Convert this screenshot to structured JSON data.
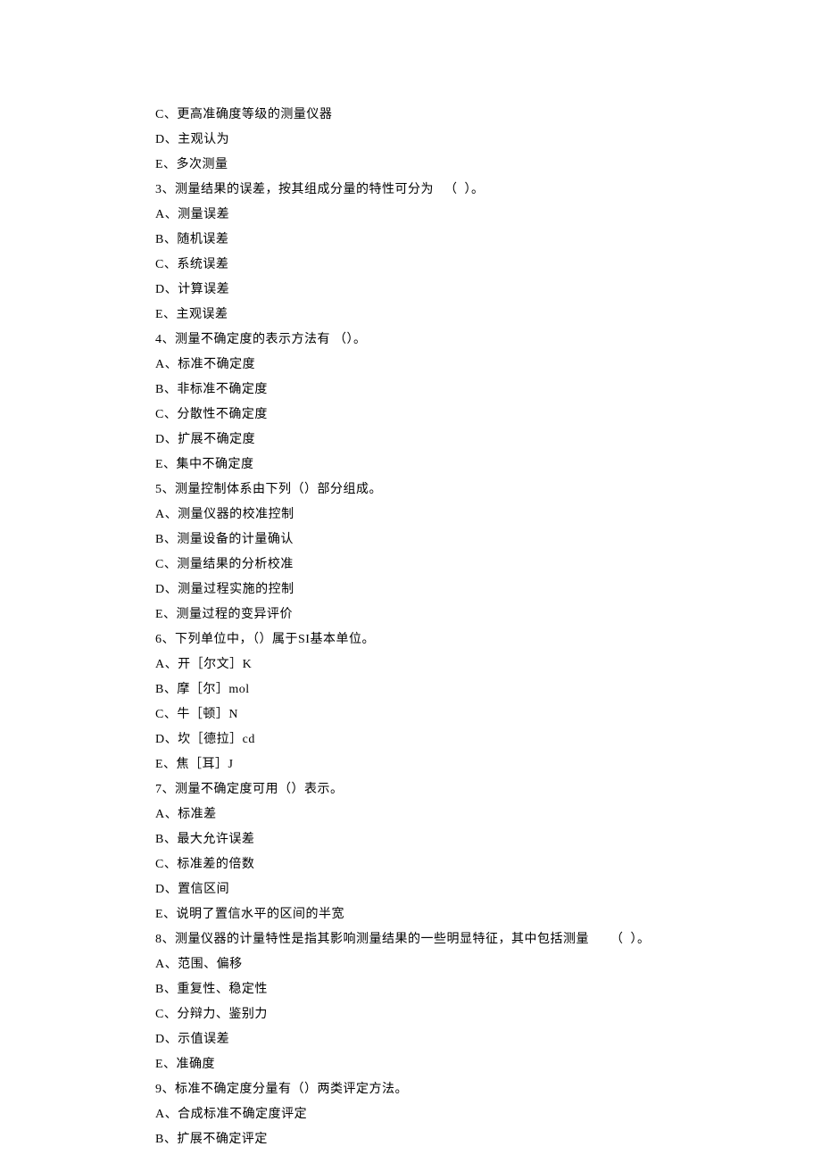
{
  "lines": [
    "C、更高准确度等级的测量仪器",
    "D、主观认为",
    "E、多次测量",
    "3、测量结果的误差，按其组成分量的特性可分为   （  ）。",
    "A、测量误差",
    "B、随机误差",
    "C、系统误差",
    "D、计算误差",
    "E、主观误差",
    "4、测量不确定度的表示方法有 （）。",
    "A、标准不确定度",
    "B、非标准不确定度",
    "C、分散性不确定度",
    "D、扩展不确定度",
    "E、集中不确定度",
    "5、测量控制体系由下列（）部分组成。",
    "A、测量仪器的校准控制",
    "B、测量设备的计量确认",
    "C、测量结果的分析校准",
    "D、测量过程实施的控制",
    "E、测量过程的变异评价",
    "6、下列单位中，（）属于SI基本单位。",
    "A、开［尔文］K",
    "B、摩［尔］mol",
    "C、牛［顿］N",
    "D、坎［德拉］cd",
    "E、焦［耳］J",
    "7、测量不确定度可用（）表示。",
    "A、标准差",
    "B、最大允许误差",
    "C、标准差的倍数",
    "D、置信区间",
    "E、说明了置信水平的区间的半宽",
    "8、测量仪器的计量特性是指其影响测量结果的一些明显特征，其中包括测量      （  ）。",
    "A、范围、偏移",
    "B、重复性、稳定性",
    "C、分辩力、鉴别力",
    "D、示值误差",
    "E、准确度",
    "9、标准不确定度分量有（）两类评定方法。",
    "A、合成标准不确定度评定",
    "B、扩展不确定评定"
  ]
}
